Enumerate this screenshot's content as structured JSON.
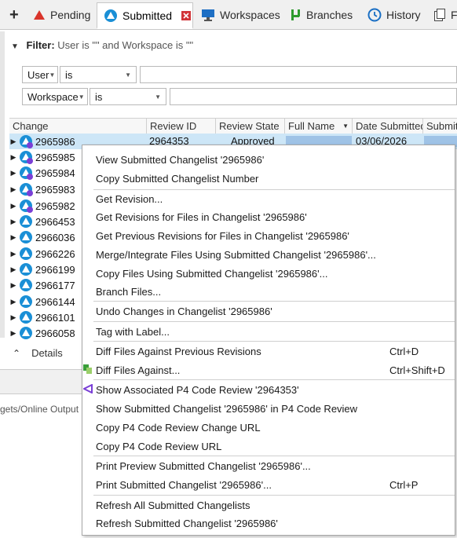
{
  "tabs": [
    {
      "label": "+",
      "icon": "add-icon"
    },
    {
      "label": "Pending",
      "icon": "pending-triangle-icon"
    },
    {
      "label": "Submitted",
      "icon": "submitted-icon",
      "active": true
    },
    {
      "label": "Workspaces",
      "icon": "workspace-monitor-icon"
    },
    {
      "label": "Branches",
      "icon": "branch-icon"
    },
    {
      "label": "History",
      "icon": "history-clock-icon"
    },
    {
      "label": "F",
      "icon": "files-icon"
    }
  ],
  "filter": {
    "label": "Filter:",
    "value": "User is \"\" and Workspace is \"\"",
    "row1": {
      "field": "User",
      "op": "is",
      "value": ""
    },
    "row2": {
      "field": "Workspace",
      "op": "is",
      "value": ""
    }
  },
  "table": {
    "columns": [
      "Change",
      "Review ID",
      "Review State",
      "Full Name",
      "Date Submitted",
      "Submit"
    ],
    "first_row": {
      "change": "2965986",
      "review_id": "2964353",
      "review_state": "Approved",
      "date": "03/06/2026"
    },
    "rows": [
      "2965986",
      "2965985",
      "2965984",
      "2965983",
      "2965982",
      "2966453",
      "2966036",
      "2966226",
      "2966199",
      "2966177",
      "2966144",
      "2966101",
      "2966058"
    ]
  },
  "bottom": {
    "details": "Details",
    "output": "gets/Online Output"
  },
  "menu": [
    {
      "label": "View Submitted Changelist '2965986'",
      "shortcut": ""
    },
    {
      "label": "Copy Submitted Changelist Number",
      "shortcut": ""
    },
    {
      "label": "Get Revision...",
      "shortcut": ""
    },
    {
      "label": "Get Revisions for Files in Changelist '2965986'",
      "shortcut": ""
    },
    {
      "label": "Get Previous Revisions for Files in Changelist '2965986'",
      "shortcut": ""
    },
    {
      "label": "Merge/Integrate Files Using Submitted Changelist '2965986'...",
      "shortcut": ""
    },
    {
      "label": "Copy Files Using Submitted Changelist '2965986'...",
      "shortcut": ""
    },
    {
      "label": "Branch Files...",
      "shortcut": ""
    },
    {
      "label": "Undo Changes in Changelist '2965986'",
      "shortcut": ""
    },
    {
      "label": "Tag with Label...",
      "shortcut": ""
    },
    {
      "label": "Diff Files Against Previous Revisions",
      "shortcut": "Ctrl+D"
    },
    {
      "label": "Diff Files Against...",
      "shortcut": "Ctrl+Shift+D"
    },
    {
      "label": "Show Associated P4 Code Review '2964353'",
      "shortcut": ""
    },
    {
      "label": "Show Submitted Changelist '2965986' in P4 Code Review",
      "shortcut": ""
    },
    {
      "label": "Copy P4 Code Review Change URL",
      "shortcut": ""
    },
    {
      "label": "Copy P4 Code Review URL",
      "shortcut": ""
    },
    {
      "label": "Print Preview Submitted Changelist '2965986'...",
      "shortcut": ""
    },
    {
      "label": "Print Submitted Changelist '2965986'...",
      "shortcut": "Ctrl+P"
    },
    {
      "label": "Refresh All Submitted Changelists",
      "shortcut": ""
    },
    {
      "label": "Refresh Submitted Changelist '2965986'",
      "shortcut": ""
    }
  ],
  "colors": {
    "accent": "#1a8fd6",
    "pending": "#d9342b",
    "branch": "#2e9b2e",
    "review": "#7a3fd6",
    "selection": "#cde6f7"
  }
}
